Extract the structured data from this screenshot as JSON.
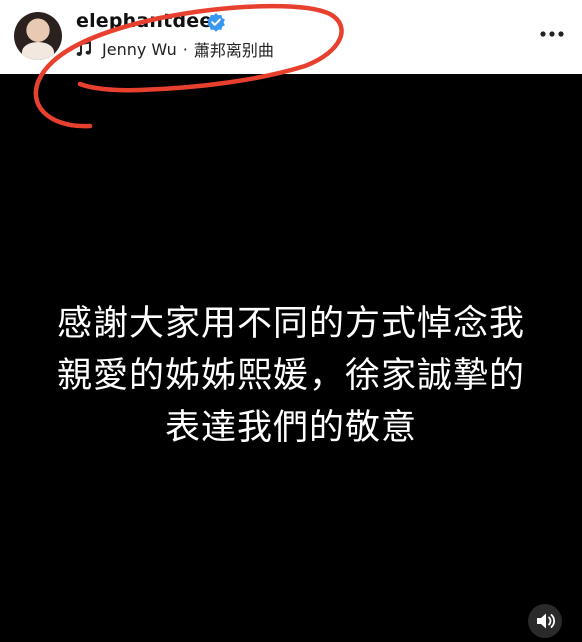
{
  "header": {
    "username": "elephantdee",
    "music_artist": "Jenny Wu",
    "music_separator": "·",
    "music_title": "蕭邦离别曲",
    "icons": {
      "verified": "verified-badge-icon",
      "music": "music-note-icon",
      "more": "more-options-icon"
    }
  },
  "story": {
    "lines": [
      "感謝大家用不同的方式悼念我",
      "親愛的姊姊熙媛，徐家誠摯的",
      "表達我們的敬意"
    ]
  },
  "controls": {
    "sound_icon": "speaker-icon"
  },
  "colors": {
    "verified": "#3897f0",
    "annotation": "#e8402e",
    "background": "#000000",
    "header_bg": "#ffffff"
  }
}
